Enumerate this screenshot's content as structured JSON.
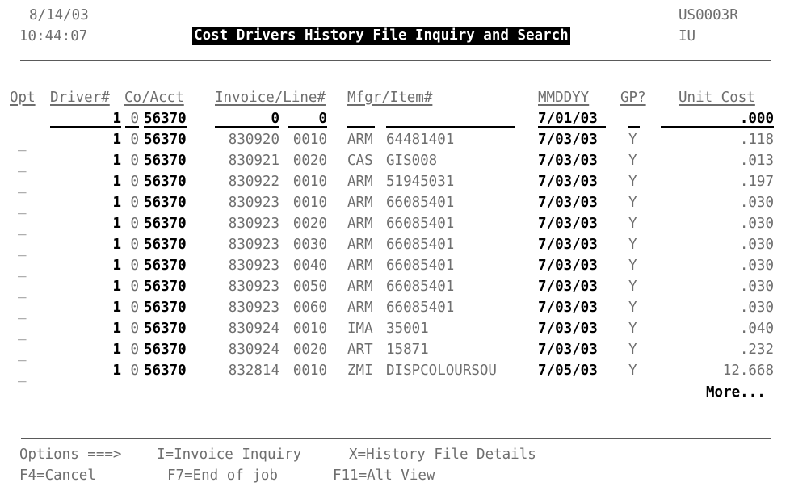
{
  "header": {
    "date": "8/14/03",
    "time": "10:44:07",
    "title": "Cost Drivers History File Inquiry and Search",
    "program_id": "US0003R",
    "mode": "IU"
  },
  "columns": {
    "opt": "Opt",
    "driver": "Driver#",
    "co_acct": "Co/Acct",
    "invoice_line": "Invoice/Line#",
    "mfgr_item": "Mfgr/Item#",
    "mmddyy": "MMDDYY",
    "gp": "GP?",
    "unit_cost": "Unit Cost"
  },
  "search_row": {
    "driver": "1",
    "co": "0",
    "acct": "56370",
    "invoice": "0",
    "line": "0",
    "mfgr": "",
    "item": "",
    "mmddyy": "7/01/03",
    "gp": "",
    "unit_cost": ".000"
  },
  "rows": [
    {
      "opt": "_",
      "driver": "1",
      "co": "0",
      "acct": "56370",
      "invoice": "830920",
      "line": "0010",
      "mfgr": "ARM",
      "item": "64481401",
      "mmddyy": "7/03/03",
      "gp": "Y",
      "unit_cost": ".118"
    },
    {
      "opt": "_",
      "driver": "1",
      "co": "0",
      "acct": "56370",
      "invoice": "830921",
      "line": "0020",
      "mfgr": "CAS",
      "item": "GIS008",
      "mmddyy": "7/03/03",
      "gp": "Y",
      "unit_cost": ".013"
    },
    {
      "opt": "_",
      "driver": "1",
      "co": "0",
      "acct": "56370",
      "invoice": "830922",
      "line": "0010",
      "mfgr": "ARM",
      "item": "51945031",
      "mmddyy": "7/03/03",
      "gp": "Y",
      "unit_cost": ".197"
    },
    {
      "opt": "_",
      "driver": "1",
      "co": "0",
      "acct": "56370",
      "invoice": "830923",
      "line": "0010",
      "mfgr": "ARM",
      "item": "66085401",
      "mmddyy": "7/03/03",
      "gp": "Y",
      "unit_cost": ".030"
    },
    {
      "opt": "_",
      "driver": "1",
      "co": "0",
      "acct": "56370",
      "invoice": "830923",
      "line": "0020",
      "mfgr": "ARM",
      "item": "66085401",
      "mmddyy": "7/03/03",
      "gp": "Y",
      "unit_cost": ".030"
    },
    {
      "opt": "_",
      "driver": "1",
      "co": "0",
      "acct": "56370",
      "invoice": "830923",
      "line": "0030",
      "mfgr": "ARM",
      "item": "66085401",
      "mmddyy": "7/03/03",
      "gp": "Y",
      "unit_cost": ".030"
    },
    {
      "opt": "_",
      "driver": "1",
      "co": "0",
      "acct": "56370",
      "invoice": "830923",
      "line": "0040",
      "mfgr": "ARM",
      "item": "66085401",
      "mmddyy": "7/03/03",
      "gp": "Y",
      "unit_cost": ".030"
    },
    {
      "opt": "_",
      "driver": "1",
      "co": "0",
      "acct": "56370",
      "invoice": "830923",
      "line": "0050",
      "mfgr": "ARM",
      "item": "66085401",
      "mmddyy": "7/03/03",
      "gp": "Y",
      "unit_cost": ".030"
    },
    {
      "opt": "_",
      "driver": "1",
      "co": "0",
      "acct": "56370",
      "invoice": "830923",
      "line": "0060",
      "mfgr": "ARM",
      "item": "66085401",
      "mmddyy": "7/03/03",
      "gp": "Y",
      "unit_cost": ".030"
    },
    {
      "opt": "_",
      "driver": "1",
      "co": "0",
      "acct": "56370",
      "invoice": "830924",
      "line": "0010",
      "mfgr": "IMA",
      "item": "35001",
      "mmddyy": "7/03/03",
      "gp": "Y",
      "unit_cost": ".040"
    },
    {
      "opt": "_",
      "driver": "1",
      "co": "0",
      "acct": "56370",
      "invoice": "830924",
      "line": "0020",
      "mfgr": "ART",
      "item": "15871",
      "mmddyy": "7/03/03",
      "gp": "Y",
      "unit_cost": ".232"
    },
    {
      "opt": "_",
      "driver": "1",
      "co": "0",
      "acct": "56370",
      "invoice": "832814",
      "line": "0010",
      "mfgr": "ZMI",
      "item": "DISPCOLOURSOU",
      "mmddyy": "7/05/03",
      "gp": "Y",
      "unit_cost": "12.668"
    }
  ],
  "more_indicator": "More...",
  "footer": {
    "options_prompt": "Options ===>",
    "option_invoice": "I=Invoice Inquiry",
    "option_history": "X=History File Details",
    "f4": "F4=Cancel",
    "f7": "F7=End of job",
    "f11": "F11=Alt View"
  }
}
